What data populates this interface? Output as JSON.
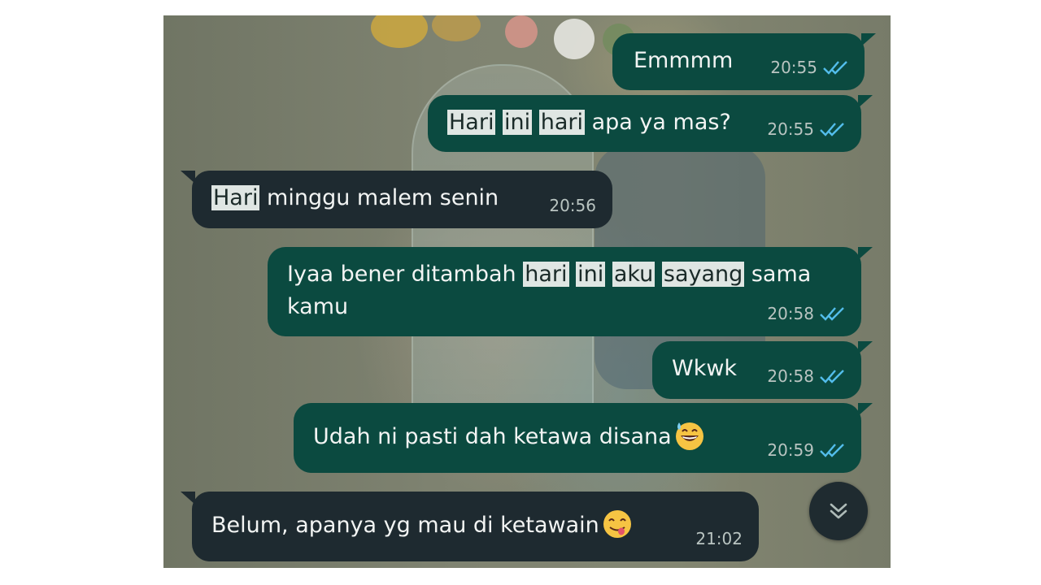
{
  "messages": [
    {
      "id": "m1",
      "direction": "outgoing",
      "segments": [
        {
          "t": "Emmmm",
          "hl": false
        }
      ],
      "time": "20:55",
      "read": true
    },
    {
      "id": "m2",
      "direction": "outgoing",
      "segments": [
        {
          "t": "Hari",
          "hl": true
        },
        {
          "t": " ",
          "hl": false
        },
        {
          "t": "ini",
          "hl": true
        },
        {
          "t": " ",
          "hl": false
        },
        {
          "t": "hari",
          "hl": true
        },
        {
          "t": " apa ya mas?",
          "hl": false
        }
      ],
      "time": "20:55",
      "read": true
    },
    {
      "id": "m3",
      "direction": "incoming",
      "segments": [
        {
          "t": "Hari",
          "hl": true
        },
        {
          "t": " minggu malem senin",
          "hl": false
        }
      ],
      "time": "20:56",
      "read": false
    },
    {
      "id": "m4",
      "direction": "outgoing",
      "segments": [
        {
          "t": "Iyaa bener ditambah ",
          "hl": false
        },
        {
          "t": "hari",
          "hl": true
        },
        {
          "t": " ",
          "hl": false
        },
        {
          "t": "ini",
          "hl": true
        },
        {
          "t": " ",
          "hl": false
        },
        {
          "t": "aku",
          "hl": true
        },
        {
          "t": " ",
          "hl": false
        },
        {
          "t": "sayang",
          "hl": true
        },
        {
          "t": " sama kamu",
          "hl": false
        }
      ],
      "time": "20:58",
      "read": true
    },
    {
      "id": "m5",
      "direction": "outgoing",
      "segments": [
        {
          "t": "Wkwk",
          "hl": false
        }
      ],
      "time": "20:58",
      "read": true
    },
    {
      "id": "m6",
      "direction": "outgoing",
      "segments": [
        {
          "t": "Udah ni pasti dah ketawa disana",
          "hl": false
        }
      ],
      "emoji": "grinning-sweat-emoji",
      "time": "20:59",
      "read": true
    },
    {
      "id": "m7",
      "direction": "incoming",
      "segments": [
        {
          "t": "Belum, apanya yg mau di ketawain",
          "hl": false
        }
      ],
      "emoji": "yum-emoji",
      "time": "21:02",
      "read": false
    }
  ],
  "colors": {
    "outgoing_bubble": "#0b4a40",
    "incoming_bubble": "#1e2a30",
    "read_ticks": "#53bdeb",
    "highlight": "#dfe6e3"
  },
  "scroll_button": {
    "icon": "double-chevron-down-icon"
  }
}
